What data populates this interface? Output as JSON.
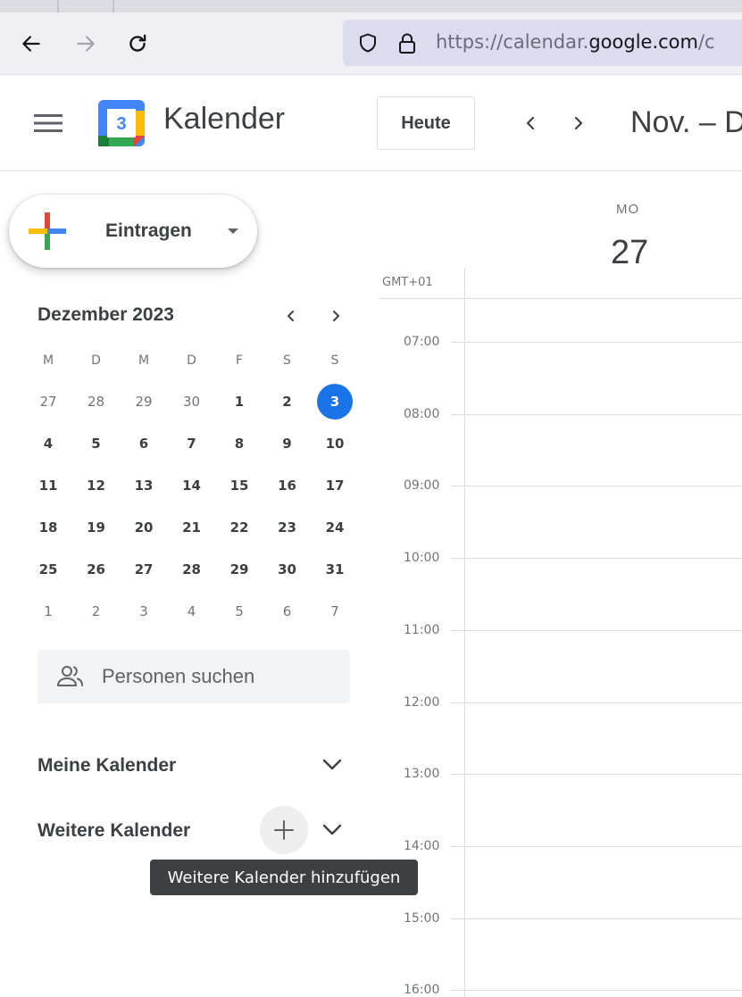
{
  "browser": {
    "url_scheme": "https://calendar.",
    "url_domain": "google.com",
    "url_rest": "/c"
  },
  "header": {
    "logo_day": "3",
    "app_title": "Kalender",
    "today_label": "Heute",
    "range_title": "Nov. – D"
  },
  "sidebar": {
    "create_label": "Eintragen",
    "mini_calendar": {
      "title": "Dezember 2023",
      "weekdays": [
        "M",
        "D",
        "M",
        "D",
        "F",
        "S",
        "S"
      ],
      "weeks": [
        [
          "27",
          "28",
          "29",
          "30",
          "1",
          "2",
          "3"
        ],
        [
          "4",
          "5",
          "6",
          "7",
          "8",
          "9",
          "10"
        ],
        [
          "11",
          "12",
          "13",
          "14",
          "15",
          "16",
          "17"
        ],
        [
          "18",
          "19",
          "20",
          "21",
          "22",
          "23",
          "24"
        ],
        [
          "25",
          "26",
          "27",
          "28",
          "29",
          "30",
          "31"
        ],
        [
          "1",
          "2",
          "3",
          "4",
          "5",
          "6",
          "7"
        ]
      ],
      "today": "3"
    },
    "people_search_placeholder": "Personen suchen",
    "my_calendars_label": "Meine Kalender",
    "other_calendars_label": "Weitere Kalender",
    "add_calendar_tooltip": "Weitere Kalender hinzufügen"
  },
  "grid": {
    "day_of_week": "MO",
    "day_number": "27",
    "timezone": "GMT+01",
    "hours": [
      "07:00",
      "08:00",
      "09:00",
      "10:00",
      "11:00",
      "12:00",
      "13:00",
      "14:00",
      "15:00",
      "16:00"
    ]
  },
  "colors": {
    "accent": "#1a73e8",
    "url_bar": "#dcdcf0",
    "text": "#3c4043",
    "muted": "#70757a"
  }
}
